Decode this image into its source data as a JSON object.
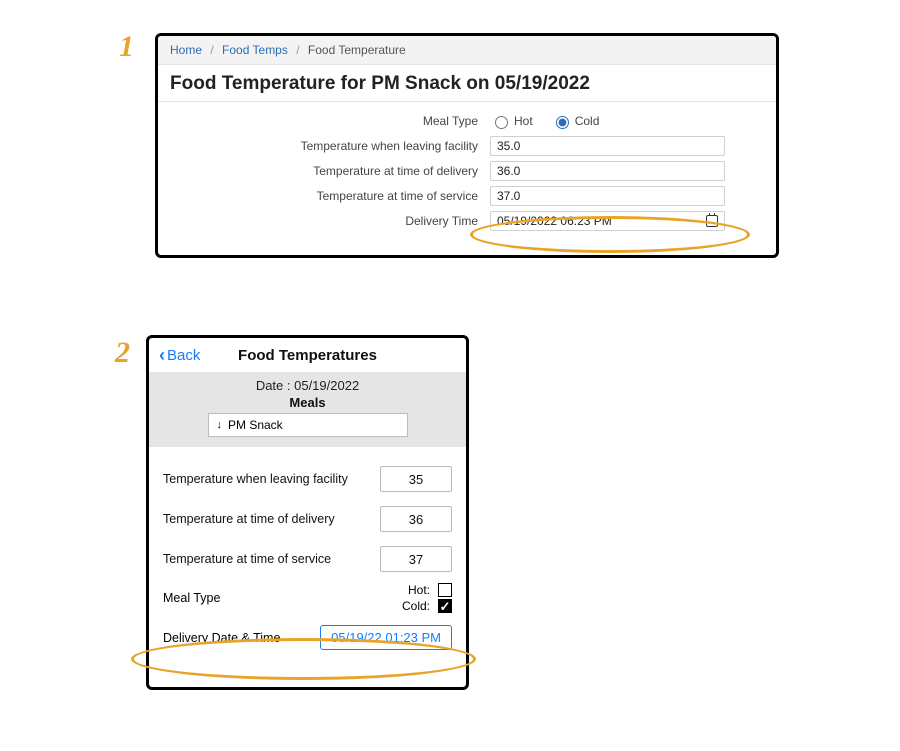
{
  "annotations": {
    "one": "1",
    "two": "2"
  },
  "panel1": {
    "breadcrumb": {
      "home": "Home",
      "foodtemps": "Food Temps",
      "current": "Food Temperature"
    },
    "title": "Food Temperature for PM Snack on 05/19/2022",
    "labels": {
      "meal_type": "Meal Type",
      "temp_leaving": "Temperature when leaving facility",
      "temp_delivery": "Temperature at time of delivery",
      "temp_service": "Temperature at time of service",
      "delivery_time": "Delivery Time"
    },
    "radios": {
      "hot": "Hot",
      "cold": "Cold",
      "selected": "cold"
    },
    "values": {
      "temp_leaving": "35.0",
      "temp_delivery": "36.0",
      "temp_service": "37.0",
      "delivery_time": "05/19/2022 06:23 PM"
    }
  },
  "panel2": {
    "back": "Back",
    "title": "Food Temperatures",
    "date_label": "Date : 05/19/2022",
    "meals_label": "Meals",
    "meal_selected": "PM Snack",
    "rows": {
      "temp_leaving": {
        "label": "Temperature when leaving facility",
        "value": "35"
      },
      "temp_delivery": {
        "label": "Temperature at time of delivery",
        "value": "36"
      },
      "temp_service": {
        "label": "Temperature at time of service",
        "value": "37"
      }
    },
    "meal_type_label": "Meal Type",
    "checks": {
      "hot_label": "Hot:",
      "cold_label": "Cold:",
      "hot": false,
      "cold": true
    },
    "delivery": {
      "label": "Delivery Date & Time",
      "value": "05/19/22 01:23 PM"
    }
  }
}
